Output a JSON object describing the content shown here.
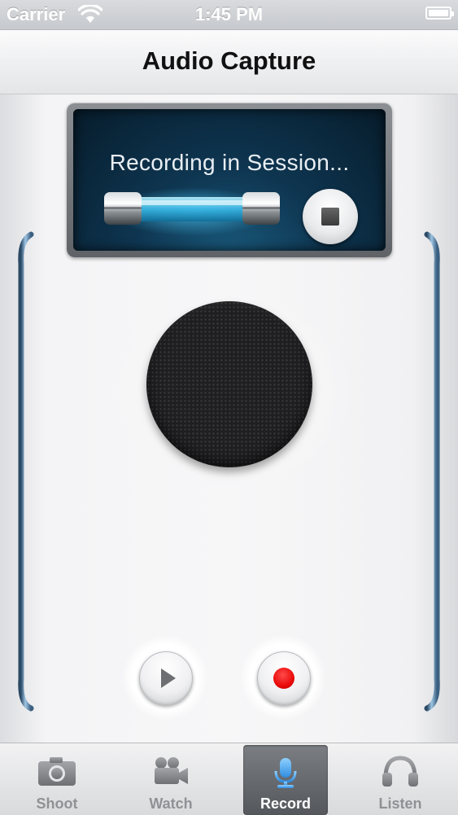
{
  "status_bar": {
    "carrier": "Carrier",
    "time": "1:45 PM",
    "battery_level_percent": 100
  },
  "nav": {
    "title": "Audio Capture"
  },
  "display": {
    "status_text": "Recording in Session..."
  },
  "tabs": [
    {
      "label": "Shoot",
      "icon": "camera-icon",
      "active": false
    },
    {
      "label": "Watch",
      "icon": "video-camera-icon",
      "active": false
    },
    {
      "label": "Record",
      "icon": "microphone-icon",
      "active": true
    },
    {
      "label": "Listen",
      "icon": "headphones-icon",
      "active": false
    }
  ],
  "colors": {
    "record_red": "#e60000",
    "active_icon_blue": "#2f8de0",
    "screen_glow": "#38b7e6"
  }
}
